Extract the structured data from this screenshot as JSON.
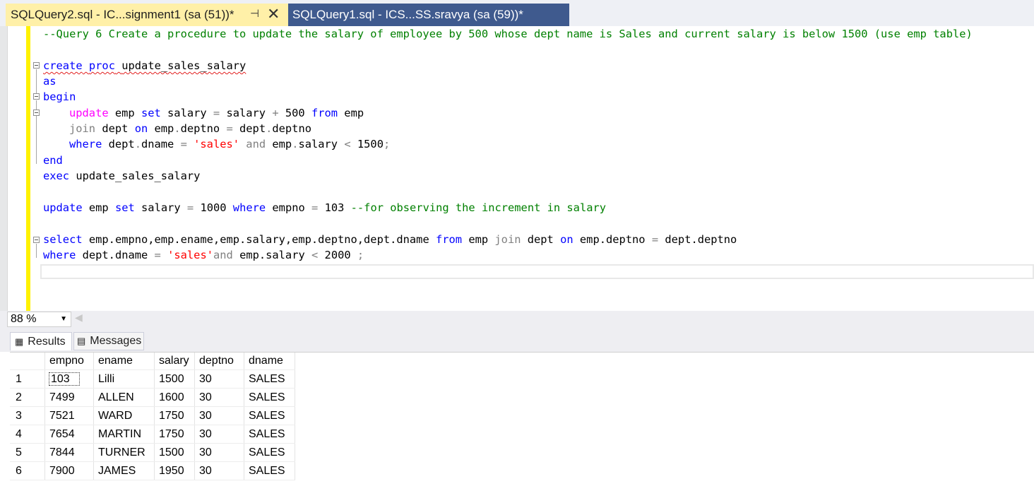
{
  "tabs": [
    {
      "label": "SQLQuery2.sql - IC...signment1 (sa (51))*",
      "pin_icon": "pin-icon",
      "close_icon": "close-icon"
    },
    {
      "label": "SQLQuery1.sql - ICS...SS.sravya (sa (59))*"
    }
  ],
  "editor": {
    "comment": "--Query 6 Create a procedure to update the salary of employee by 500 whose dept name is Sales and current salary is below 1500 (use emp table)",
    "create": "create",
    "proc": "proc",
    "proc_name": "update_sales_salary",
    "as": "as",
    "begin": "begin",
    "update1": "update",
    "update1_rest1": " emp ",
    "set1": "set",
    "update1_rest2": " salary ",
    "eq1": "=",
    "update1_rest3": " salary ",
    "plus": "+",
    "update1_rest4": " 500 ",
    "from1": "from",
    "update1_rest5": " emp",
    "join1": "join",
    "join1_rest1": " dept ",
    "on1": "on",
    "join1_rest2": " emp",
    "dot1": ".",
    "join1_rest3": "deptno ",
    "eq2": "=",
    "join1_rest4": " dept",
    "dot2": ".",
    "join1_rest5": "deptno",
    "where1": "where",
    "where1_rest1": " dept",
    "dot3": ".",
    "where1_rest2": "dname ",
    "eq3": "=",
    "str_sales1": "'sales'",
    "and1": "and",
    "where1_rest3": " emp",
    "dot4": ".",
    "where1_rest4": "salary ",
    "lt1": "<",
    "where1_rest5": " 1500",
    "semi1": ";",
    "end": "end",
    "exec": "exec",
    "exec_name": " update_sales_salary",
    "update2": "update",
    "update2_rest1": " emp ",
    "set2": "set",
    "update2_rest2": " salary ",
    "eq4": "=",
    "update2_rest3": " 1000 ",
    "where2": "where",
    "update2_rest4": " empno ",
    "eq5": "=",
    "update2_rest5": " 103 ",
    "comment2": "--for observing the increment in salary",
    "select": "select",
    "select_cols": " emp.empno,emp.ename,emp.salary,emp.deptno,dept.dname ",
    "from2": "from",
    "select_rest1": " emp ",
    "join2": "join",
    "select_rest2": " dept ",
    "on2": "on",
    "select_rest3": " emp.deptno ",
    "eq6": "=",
    "select_rest4": " dept.deptno",
    "where3": "where",
    "where3_rest1": " dept.dname ",
    "eq7": "=",
    "str_sales2": "'sales'",
    "and2": "and",
    "where3_rest2": " emp.salary ",
    "lt2": "<",
    "where3_rest3": " 2000 ",
    "semi2": ";"
  },
  "zoom": {
    "value": "88 %"
  },
  "result_tabs": [
    {
      "label": "Results",
      "icon": "grid-icon"
    },
    {
      "label": "Messages",
      "icon": "messages-icon"
    }
  ],
  "grid": {
    "columns": [
      "empno",
      "ename",
      "salary",
      "deptno",
      "dname"
    ],
    "rows": [
      [
        "1",
        "103",
        "Lilli",
        "1500",
        "30",
        "SALES"
      ],
      [
        "2",
        "7499",
        "ALLEN",
        "1600",
        "30",
        "SALES"
      ],
      [
        "3",
        "7521",
        "WARD",
        "1750",
        "30",
        "SALES"
      ],
      [
        "4",
        "7654",
        "MARTIN",
        "1750",
        "30",
        "SALES"
      ],
      [
        "5",
        "7844",
        "TURNER",
        "1500",
        "30",
        "SALES"
      ],
      [
        "6",
        "7900",
        "JAMES",
        "1950",
        "30",
        "SALES"
      ]
    ]
  }
}
